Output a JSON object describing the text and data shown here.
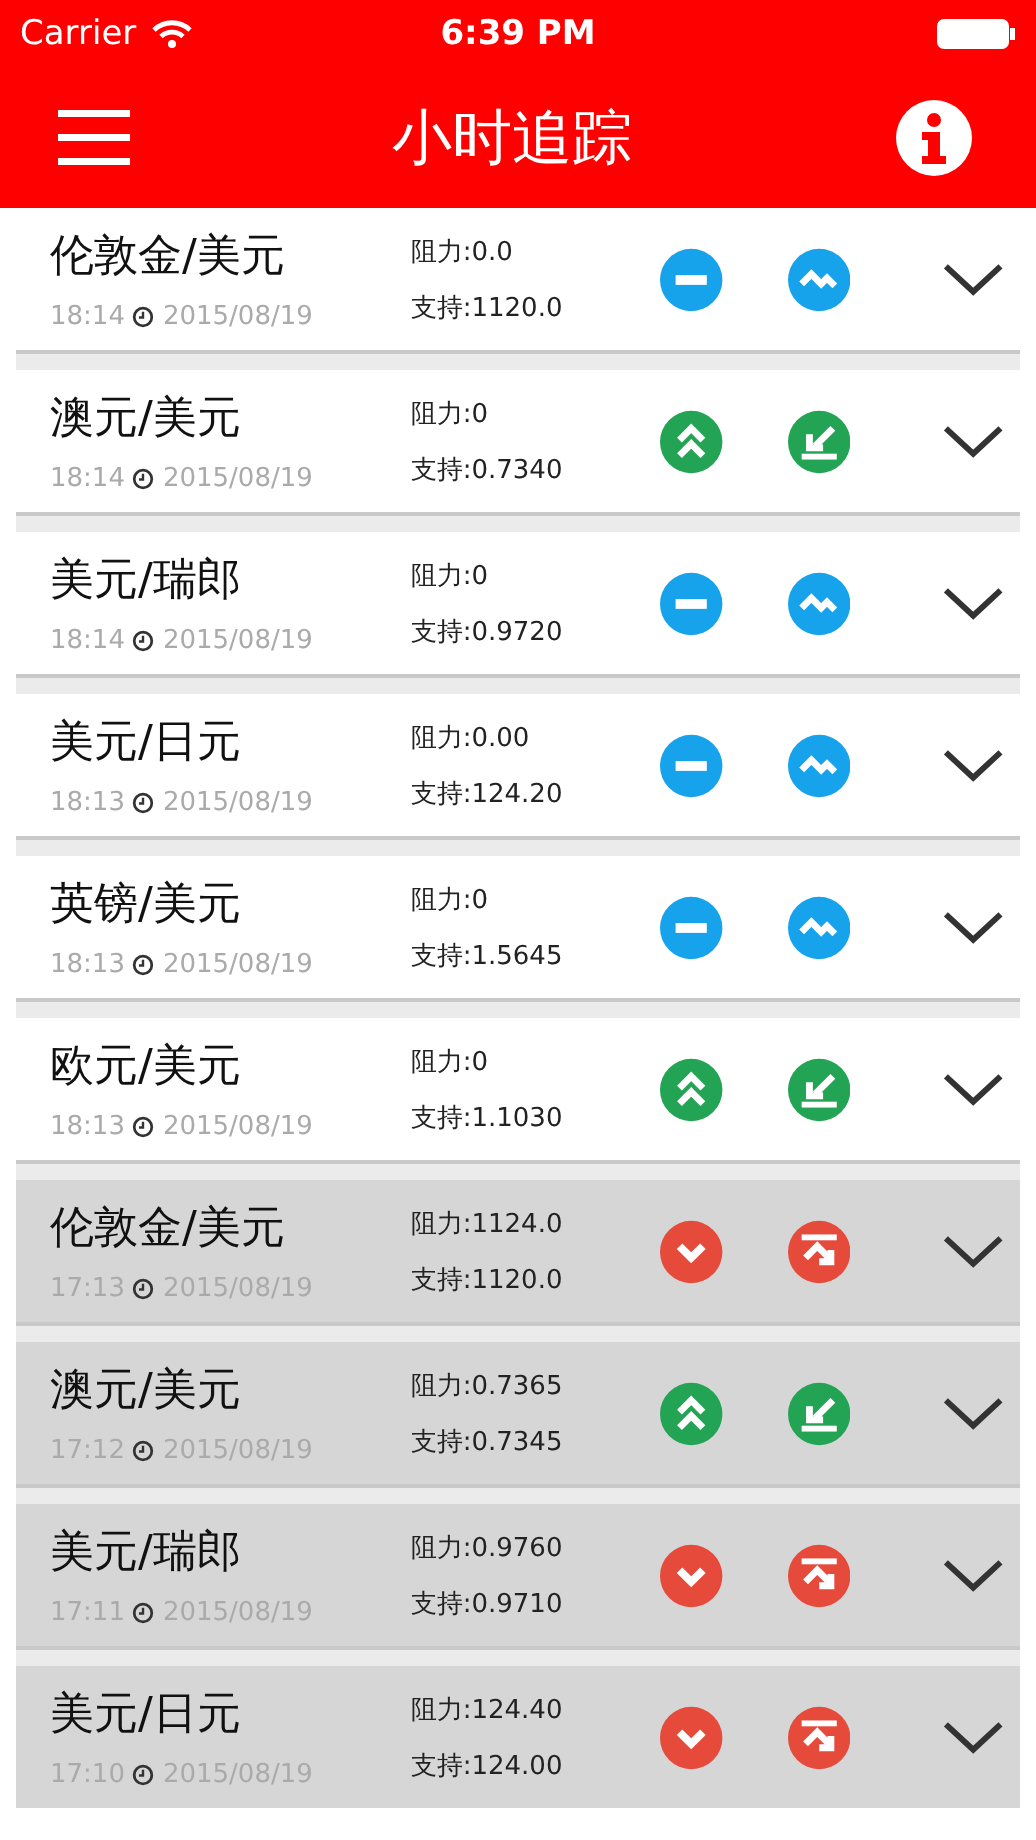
{
  "status_bar": {
    "carrier": "Carrier",
    "time": "6:39 PM"
  },
  "nav": {
    "title": "小时追踪"
  },
  "rows": [
    {
      "pair": "伦敦金/美元",
      "time": "18:14",
      "date": "2015/08/19",
      "resistance": "阻力:0.0",
      "support": "支持:1120.0",
      "kind": "neutral",
      "dimmed": false
    },
    {
      "pair": "澳元/美元",
      "time": "18:14",
      "date": "2015/08/19",
      "resistance": "阻力:0",
      "support": "支持:0.7340",
      "kind": "bullish",
      "dimmed": false
    },
    {
      "pair": "美元/瑞郎",
      "time": "18:14",
      "date": "2015/08/19",
      "resistance": "阻力:0",
      "support": "支持:0.9720",
      "kind": "neutral",
      "dimmed": false
    },
    {
      "pair": "美元/日元",
      "time": "18:13",
      "date": "2015/08/19",
      "resistance": "阻力:0.00",
      "support": "支持:124.20",
      "kind": "neutral",
      "dimmed": false
    },
    {
      "pair": "英镑/美元",
      "time": "18:13",
      "date": "2015/08/19",
      "resistance": "阻力:0",
      "support": "支持:1.5645",
      "kind": "neutral",
      "dimmed": false
    },
    {
      "pair": "欧元/美元",
      "time": "18:13",
      "date": "2015/08/19",
      "resistance": "阻力:0",
      "support": "支持:1.1030",
      "kind": "bullish",
      "dimmed": false
    },
    {
      "pair": "伦敦金/美元",
      "time": "17:13",
      "date": "2015/08/19",
      "resistance": "阻力:1124.0",
      "support": "支持:1120.0",
      "kind": "bearish",
      "dimmed": true
    },
    {
      "pair": "澳元/美元",
      "time": "17:12",
      "date": "2015/08/19",
      "resistance": "阻力:0.7365",
      "support": "支持:0.7345",
      "kind": "bullish",
      "dimmed": true
    },
    {
      "pair": "美元/瑞郎",
      "time": "17:11",
      "date": "2015/08/19",
      "resistance": "阻力:0.9760",
      "support": "支持:0.9710",
      "kind": "bearish",
      "dimmed": true
    },
    {
      "pair": "美元/日元",
      "time": "17:10",
      "date": "2015/08/19",
      "resistance": "阻力:124.40",
      "support": "支持:124.00",
      "kind": "bearish",
      "dimmed": true
    }
  ]
}
